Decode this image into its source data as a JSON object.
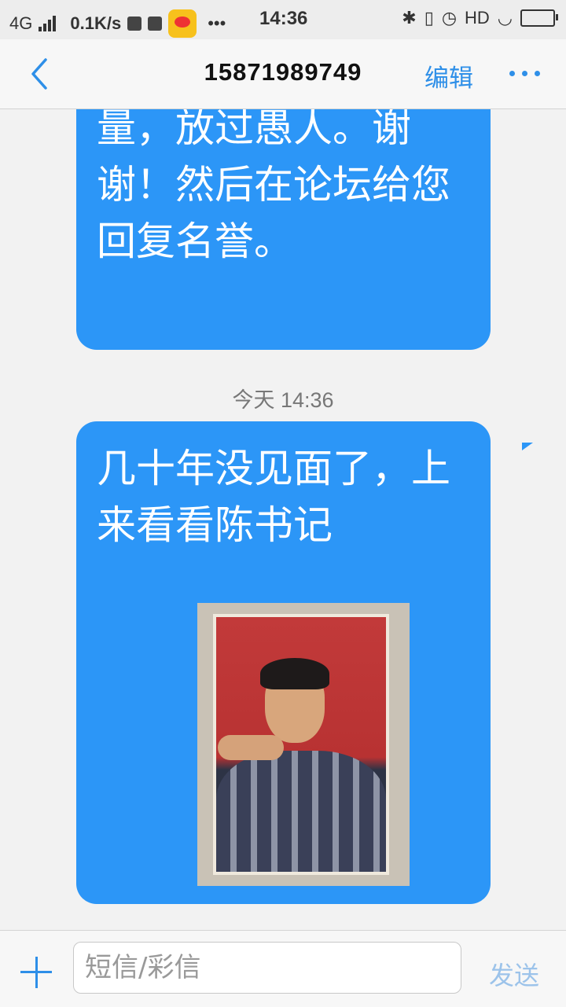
{
  "status_bar": {
    "network": "4G",
    "speed": "0.1K/s",
    "dots": "•••",
    "time": "14:36",
    "hd": "HD"
  },
  "header": {
    "title": "15871989749",
    "edit_label": "编辑"
  },
  "messages": [
    {
      "text": "量，放过愚人。谢谢！然后在论坛给您回复名誉。"
    },
    {
      "timestamp": "今天 14:36",
      "text": "几十年没见面了，上来看看陈书记"
    }
  ],
  "input": {
    "placeholder": "短信/彩信",
    "send_label": "发送"
  },
  "colors": {
    "bubble": "#2c96f7",
    "accent": "#2e8fe8"
  }
}
